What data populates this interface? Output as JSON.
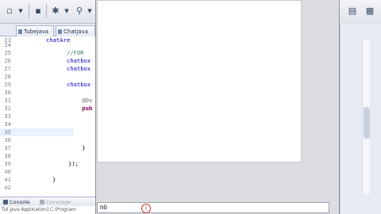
{
  "editor": {
    "tabs": [
      {
        "label": "Tubejava"
      },
      {
        "label": "Chatjava"
      }
    ],
    "lines": [
      {
        "num": "23",
        "text": "chatAre",
        "kind": "field"
      },
      {
        "num": "24",
        "text": "",
        "kind": "plain"
      },
      {
        "num": "25",
        "text": "//FOR",
        "kind": "comment"
      },
      {
        "num": "26",
        "text": "chatbox",
        "kind": "field"
      },
      {
        "num": "27",
        "text": "chatbox",
        "kind": "field"
      },
      {
        "num": "28",
        "text": "",
        "kind": "plain"
      },
      {
        "num": "29",
        "text": "chatbox",
        "kind": "field"
      },
      {
        "num": "30",
        "text": "",
        "kind": "plain"
      },
      {
        "num": "31",
        "text": "    @Ov",
        "kind": "anno"
      },
      {
        "num": "32",
        "text": "    pub",
        "kind": "kw"
      },
      {
        "num": "33",
        "text": "",
        "kind": "plain"
      },
      {
        "num": "34",
        "text": "",
        "kind": "plain"
      },
      {
        "num": "35",
        "text": "",
        "kind": "plain"
      },
      {
        "num": "36",
        "text": "",
        "kind": "plain"
      },
      {
        "num": "37",
        "text": "    }",
        "kind": "plain"
      },
      {
        "num": "38",
        "text": "",
        "kind": "plain"
      },
      {
        "num": "39",
        "text": "});",
        "kind": "plain"
      },
      {
        "num": "40",
        "text": "",
        "kind": "plain"
      },
      {
        "num": "41",
        "text": "}",
        "kind": "plain"
      },
      {
        "num": "42",
        "text": "",
        "kind": "plain"
      }
    ]
  },
  "console": {
    "tabs": [
      {
        "label": "Console"
      },
      {
        "label": "Coverage"
      }
    ],
    "status_text": "Tut Java Application] C:\\Program"
  },
  "app_window": {
    "input_value": "nö"
  },
  "icons": {
    "toolbar": [
      "new-icon",
      "save-icon",
      "print-icon",
      "debug-icon",
      "run-icon",
      "search-icon"
    ],
    "right_toolbar": [
      "java-perspective-icon",
      "debug-perspective-icon"
    ]
  }
}
